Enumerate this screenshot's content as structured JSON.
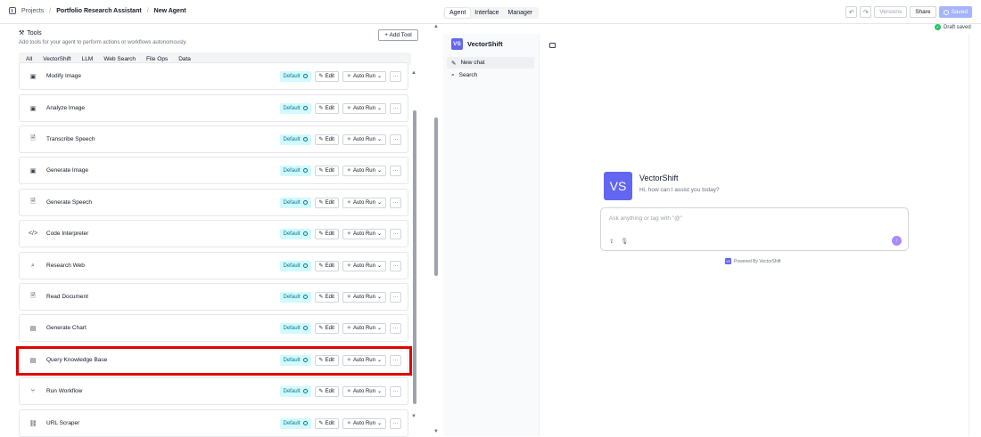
{
  "breadcrumb": {
    "root": "Projects",
    "project": "Portfolio Research Assistant",
    "page": "New Agent"
  },
  "mode_tabs": [
    {
      "label": "Agent",
      "active": true
    },
    {
      "label": "Interface",
      "active": false
    },
    {
      "label": "Manager",
      "active": false
    }
  ],
  "header_actions": {
    "undo_icon": "↶",
    "redo_icon": "↷",
    "versions": "Versions",
    "share": "Share",
    "saved": "Saved"
  },
  "tools_panel": {
    "title": "Tools",
    "subtitle": "Add tools for your agent to perform actions or workflows autonomously.",
    "add_button": "+ Add Tool",
    "filters": [
      "All",
      "VectorShift",
      "LLM",
      "Web Search",
      "File Ops",
      "Data"
    ],
    "badge": "Default",
    "edit_label": "Edit",
    "autorun_label": "Auto Run",
    "more_label": "···",
    "items": [
      {
        "name": "Modify Image",
        "icon": "image-icon",
        "glyph": "▣"
      },
      {
        "name": "Analyze Image",
        "icon": "image-icon",
        "glyph": "▣"
      },
      {
        "name": "Transcribe Speech",
        "icon": "speech-file-icon",
        "glyph": "🗎"
      },
      {
        "name": "Generate Image",
        "icon": "image-icon",
        "glyph": "▣"
      },
      {
        "name": "Generate Speech",
        "icon": "speech-file-icon",
        "glyph": "🗎"
      },
      {
        "name": "Code Interpreter",
        "icon": "code-icon",
        "glyph": "</>"
      },
      {
        "name": "Research Web",
        "icon": "search-icon",
        "glyph": "⌕"
      },
      {
        "name": "Read Document",
        "icon": "document-icon",
        "glyph": "🗎"
      },
      {
        "name": "Generate Chart",
        "icon": "chart-icon",
        "glyph": "▤"
      },
      {
        "name": "Query Knowledge Base",
        "icon": "database-icon",
        "glyph": "▤"
      },
      {
        "name": "Run Workflow",
        "icon": "workflow-icon",
        "glyph": "⑂"
      },
      {
        "name": "URL Scraper",
        "icon": "link-icon",
        "glyph": "⛓"
      }
    ]
  },
  "draft_status": "Draft saved",
  "chat_sidebar": {
    "brand": "VectorShift",
    "logo": "VS",
    "new_chat": "New chat",
    "search": "Search"
  },
  "chat_main": {
    "assistant_name": "VectorShift",
    "greeting": "Hi, how can I assist you today?",
    "input_placeholder": "Ask anything or tag with \"@\"",
    "powered_by": "Powered By VectorShift"
  }
}
